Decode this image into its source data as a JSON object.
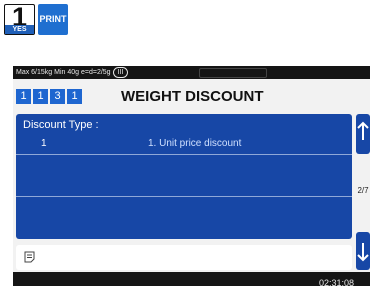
{
  "keys": {
    "yes": {
      "number": "1",
      "label": "YES"
    },
    "print": {
      "label": "PRINT"
    }
  },
  "status_bar": {
    "capacity_text": "Max 6/15kg Min 40g e=d=2/5g",
    "accuracy_class": "III"
  },
  "header": {
    "menu_code": [
      "1",
      "1",
      "3",
      "1"
    ],
    "title": "WEIGHT DISCOUNT"
  },
  "fields": [
    {
      "label": "Discount Type :",
      "index": "1",
      "value": "1. Unit price discount"
    },
    {
      "label": "",
      "index": "",
      "value": ""
    },
    {
      "label": "",
      "index": "",
      "value": ""
    }
  ],
  "page_indicator": "2/7",
  "input": {
    "icon": "memo-icon",
    "value": ""
  },
  "clock": "02:31:08",
  "colors": {
    "panel": "#1747a6",
    "accent": "#1e66d0",
    "status_bg": "#151515"
  },
  "icons": {
    "up": "arrow-up-icon",
    "down": "arrow-down-icon"
  }
}
